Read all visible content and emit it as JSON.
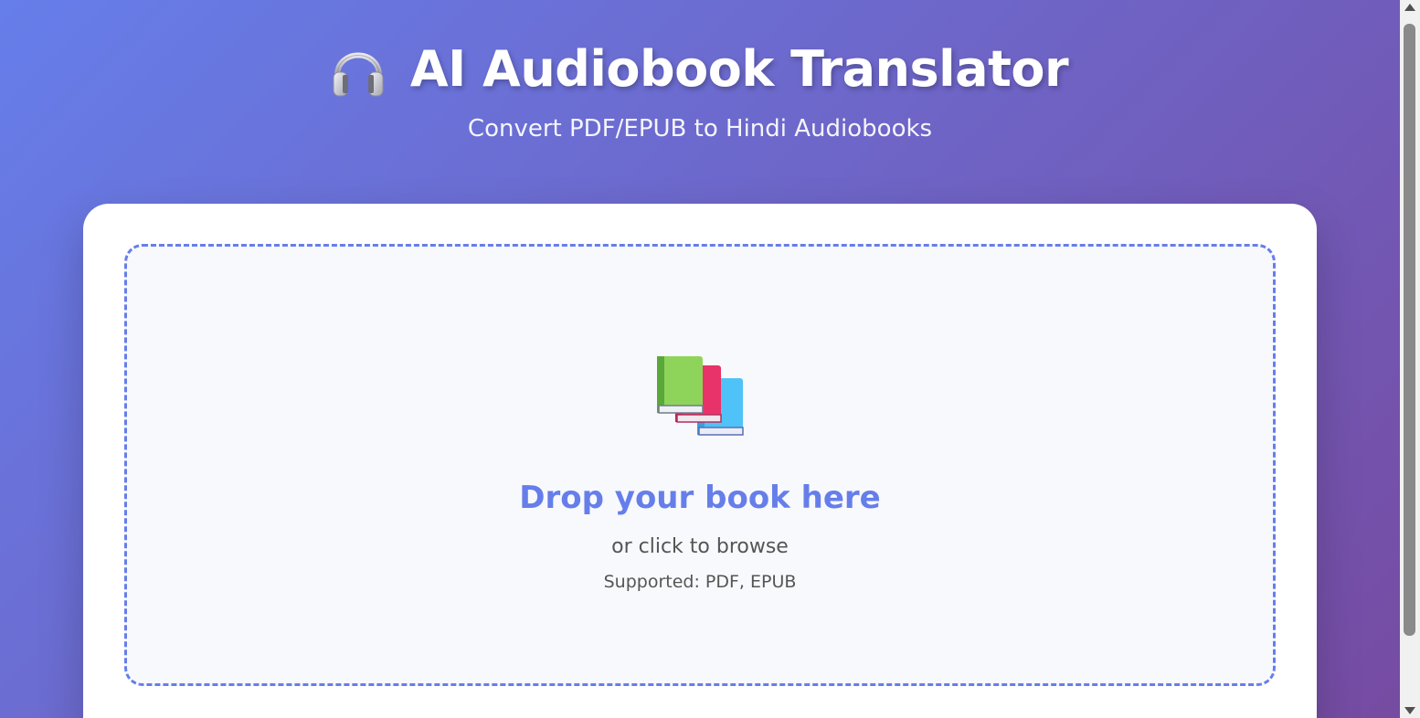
{
  "header": {
    "icon": "headphones-icon",
    "title": "AI Audiobook Translator",
    "subtitle": "Convert PDF/EPUB to Hindi Audiobooks"
  },
  "upload": {
    "icon": "books-icon",
    "title": "Drop your book here",
    "browse_text": "or click to browse",
    "supported_text": "Supported: PDF, EPUB"
  },
  "colors": {
    "gradient_start": "#667eea",
    "gradient_end": "#764ba2",
    "accent": "#667eea",
    "card_background": "#ffffff",
    "dropzone_background": "#f8f9fd"
  }
}
